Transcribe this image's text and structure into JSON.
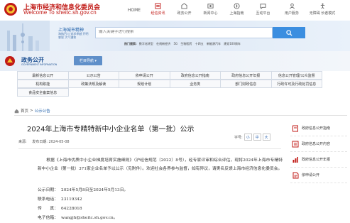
{
  "header": {
    "site_title": "上海市经济和信息化委员会",
    "site_subtitle": "Welcome To sheitc.sh.gov.cn",
    "nav": [
      {
        "label": "HOME",
        "icon": "home-icon"
      },
      {
        "label": "经信资讯",
        "icon": "news-icon"
      },
      {
        "label": "政务公开",
        "icon": "open-gov-icon"
      },
      {
        "label": "新闻中心",
        "icon": "media-icon"
      },
      {
        "label": "上海指南",
        "icon": "guide-icon"
      },
      {
        "label": "互动平台",
        "icon": "chat-icon"
      },
      {
        "label": "用户服务",
        "icon": "user-icon"
      },
      {
        "label": "无障碍 长者模式",
        "icon": "accessibility-icon"
      }
    ],
    "active_color": "#c11b17"
  },
  "hero": {
    "city_label": "上海城市精神",
    "city_sub": "海纳百川 追求卓越 开明睿智 大气谦和",
    "search_placeholder": "输入关键字进行搜索",
    "hot_label": "热门搜索:",
    "hot_terms": [
      "数字化转型",
      "在线新经济",
      "5G",
      "生物医药",
      "十四五",
      "新能源汽车",
      "建党100周年"
    ]
  },
  "band": {
    "title": "政务公开",
    "subtitle": "GOVERNMENT INFORMATION",
    "button": "栏目导航 ▾"
  },
  "categories": [
    [
      "最新信息公开",
      "公示公告",
      "依申请公开",
      "政府信息公开指南",
      "政府信息公开年报",
      "信息公开管理/公众监督"
    ],
    [
      "机构职能",
      "政策法规及解读",
      "规划计划",
      "业务类",
      "部门财政信息",
      "行政许可及行政处罚信息"
    ],
    [
      "食品安全备案信息"
    ]
  ],
  "breadcrumb": {
    "home": "首页",
    "sep": ">",
    "current": "公示公告"
  },
  "article": {
    "title": "2024年上海市专精特新中小企业名单（第一批）公示",
    "source_label": "来源:",
    "date_label": "发布日期: 2024-05-08",
    "font_size_label": "字号:",
    "font_sizes": [
      "小",
      "中",
      "大"
    ],
    "paragraph": "根据《上海市优质中小企业梯度培育实施细则》（沪经信规范〔2022〕8号），经专家评审和综合评估，现将2024年上海市专精特新中小企业（第一批）371家企业名单予以公示（见附件）。欢迎社会各界参与监督，如有异议，请実名反馈上海市经济信息化委员会。",
    "period_label": "公示日期：",
    "period_value": "2024年5月8日至2024年5月13日。",
    "phone_label": "联系电话：",
    "phone_value": "23119342",
    "fax_label": "传　　真：",
    "fax_value": "64228018",
    "email_label": "电子信箱：",
    "email_value": "wangjh@sheitc.sh.gov.cn。"
  },
  "sidebar": [
    {
      "label": "政府信息公开指南",
      "icon": "guide-book-icon"
    },
    {
      "label": "政府信息公开内容",
      "icon": "content-icon"
    },
    {
      "label": "政府信息公开年报",
      "icon": "report-icon"
    },
    {
      "label": "依申请公开",
      "icon": "apply-icon"
    }
  ]
}
